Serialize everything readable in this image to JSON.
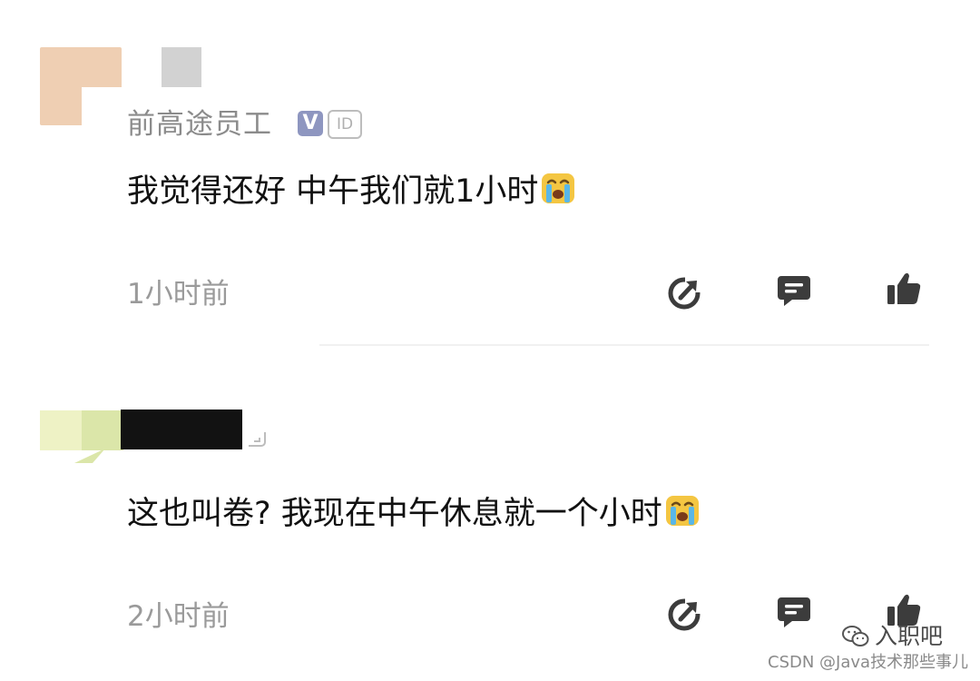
{
  "comments": [
    {
      "username": "前高途员工",
      "badges": {
        "verified": "V",
        "id": "ID"
      },
      "text": "我觉得还好 中午我们就1小时",
      "emoji": "crying-face-emoji",
      "timestamp": "1小时前"
    },
    {
      "username": "",
      "text": "这也叫卷? 我现在中午休息就一个小时",
      "emoji": "crying-face-emoji",
      "timestamp": "2小时前"
    }
  ],
  "actions": {
    "share_icon": "share-icon",
    "reply_icon": "reply-icon",
    "like_icon": "thumbs-up-icon"
  },
  "watermark": {
    "label": "入职吧",
    "source": "CSDN @Java技术那些事儿"
  },
  "colors": {
    "username": "#8b8b8b",
    "timestamp": "#9a9a9a",
    "text": "#111111",
    "icon": "#3c3c3c",
    "verified_badge": "#8e96c0"
  }
}
